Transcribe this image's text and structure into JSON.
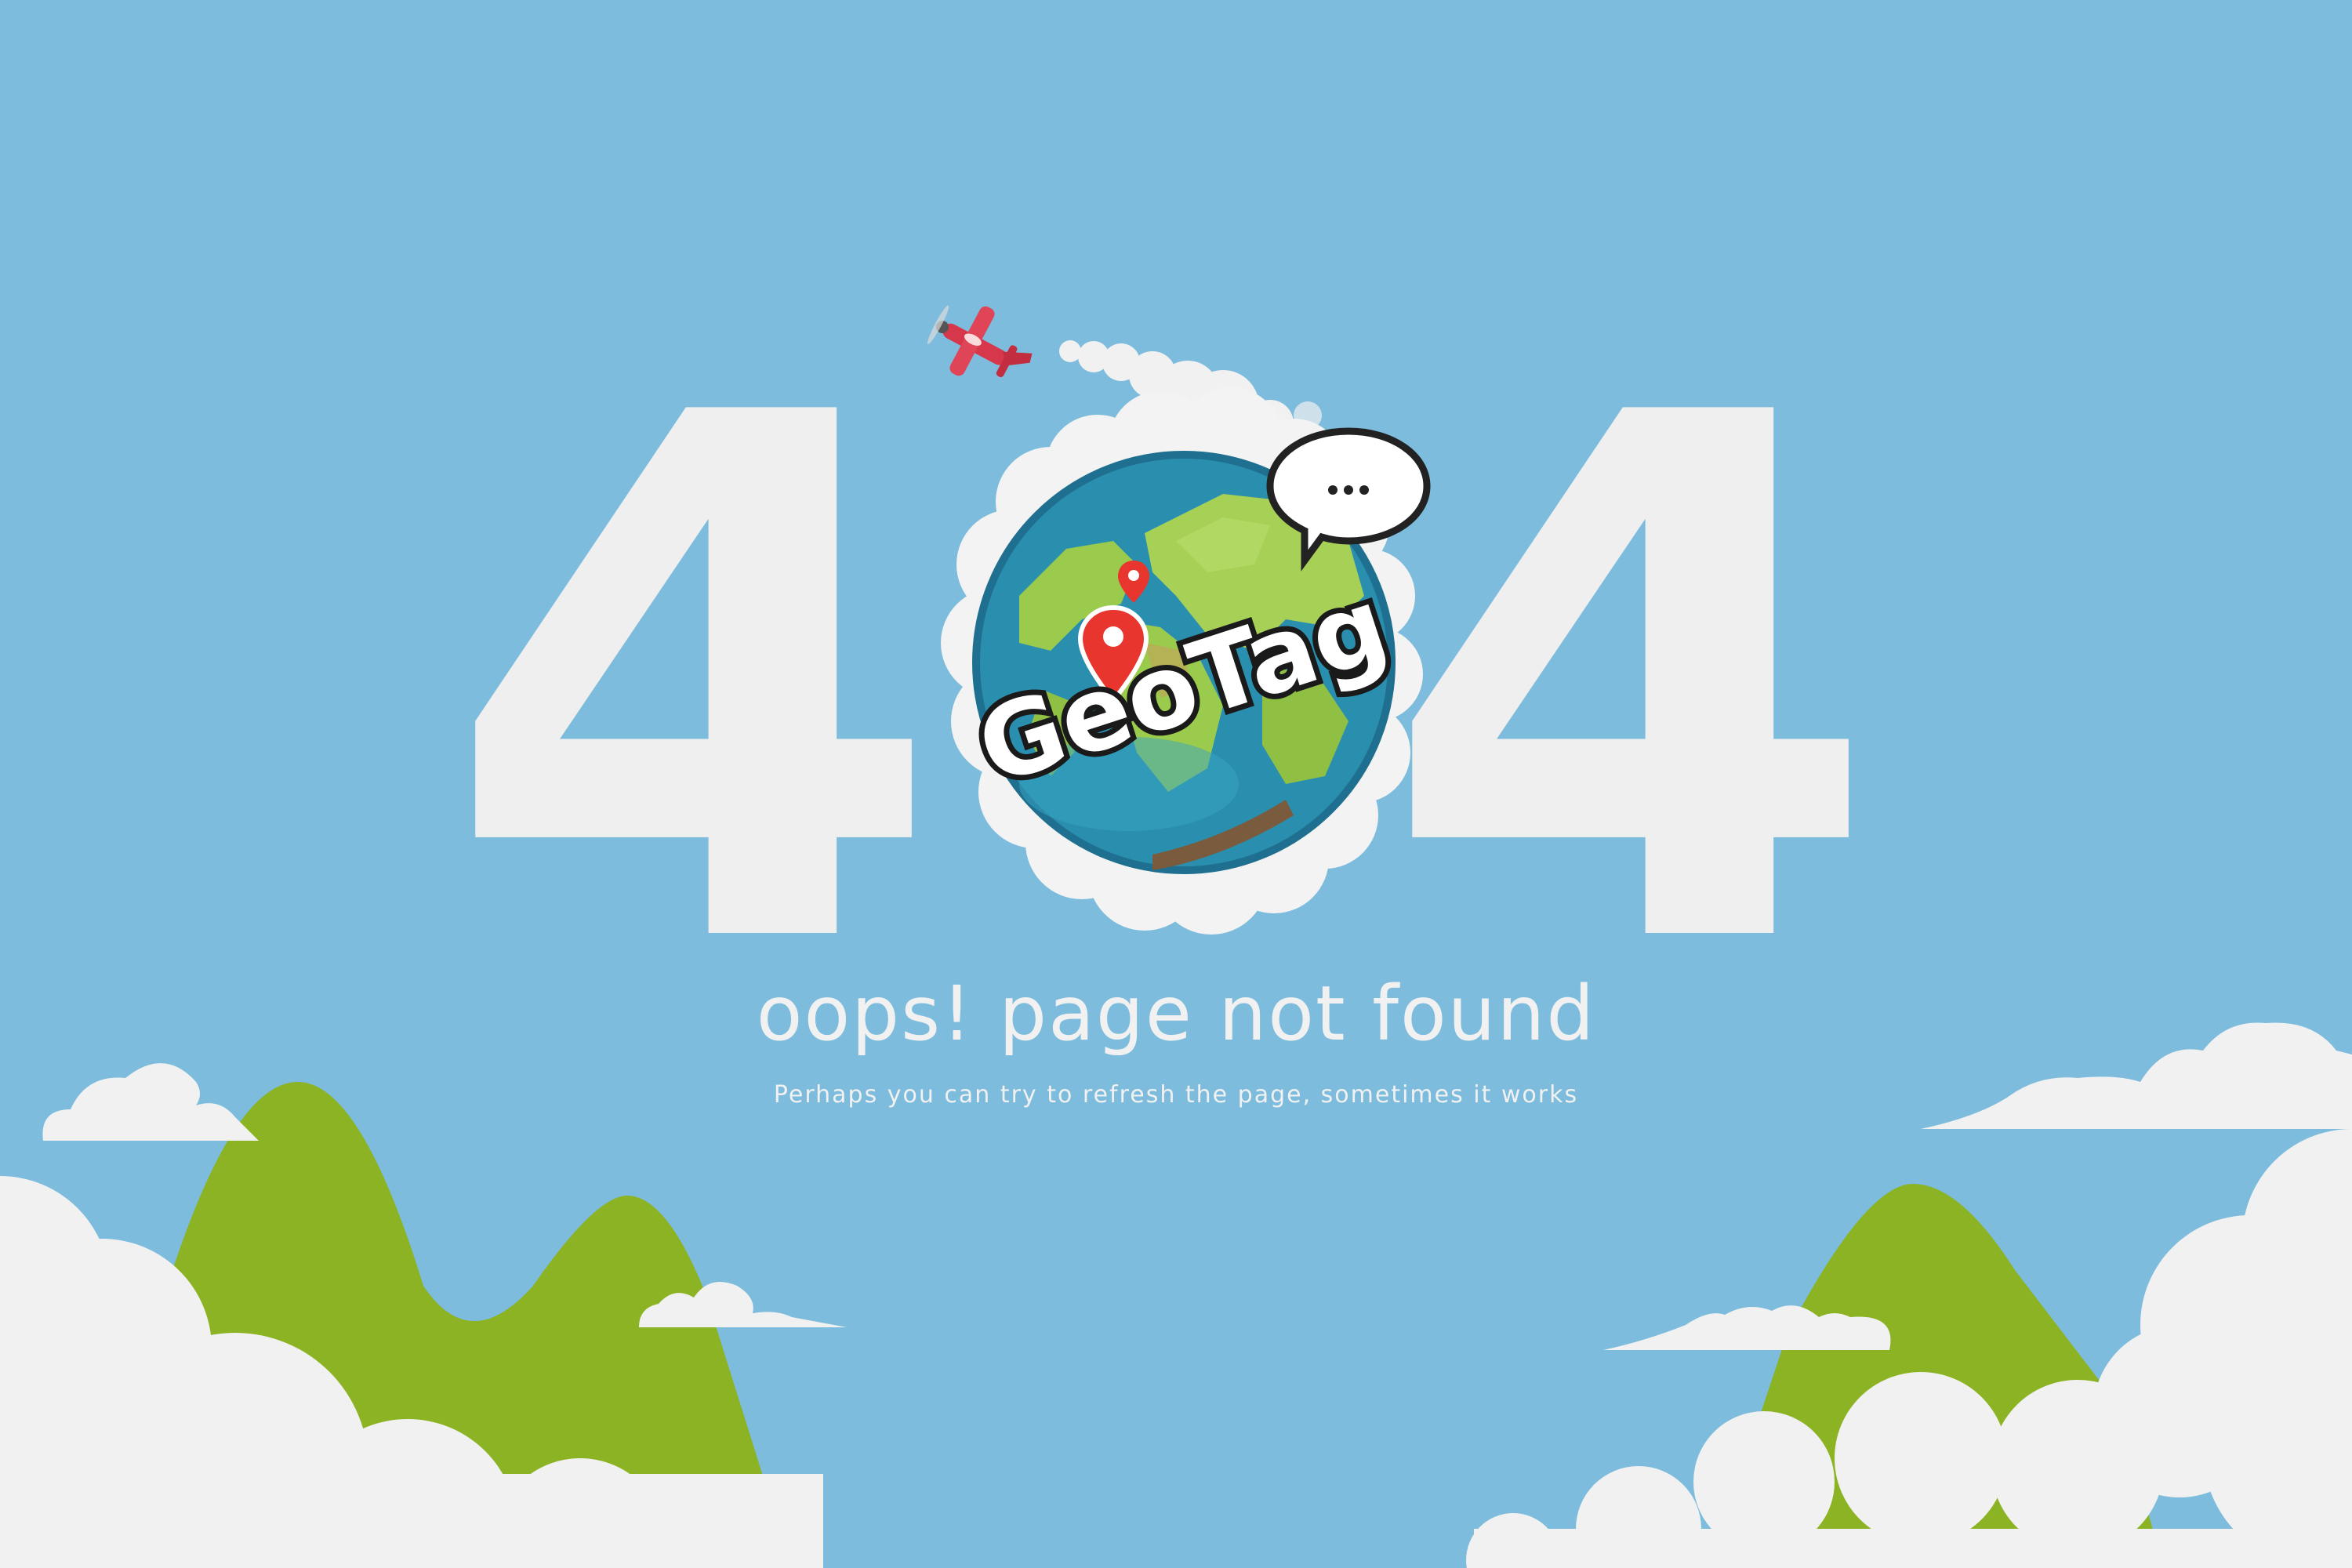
{
  "page": {
    "error_code_left": "4",
    "error_code_right": "4",
    "headline": "oops! page not found",
    "subtext": "Perhaps you can try to refresh the page, sometimes it works"
  },
  "logo": {
    "text": "GeoTag"
  },
  "colors": {
    "sky": "#7dbcdc",
    "cloud": "#f1f1f1",
    "hill": "#8bb323",
    "digits": "#efefef",
    "ocean": "#2a8fae",
    "land": "#9acb4c",
    "pin": "#e8352d",
    "plane": "#d7374a"
  },
  "icons": {
    "plane": "airplane-icon",
    "speech": "speech-bubble-icon",
    "pin": "map-pin-icon",
    "globe": "globe-icon"
  }
}
